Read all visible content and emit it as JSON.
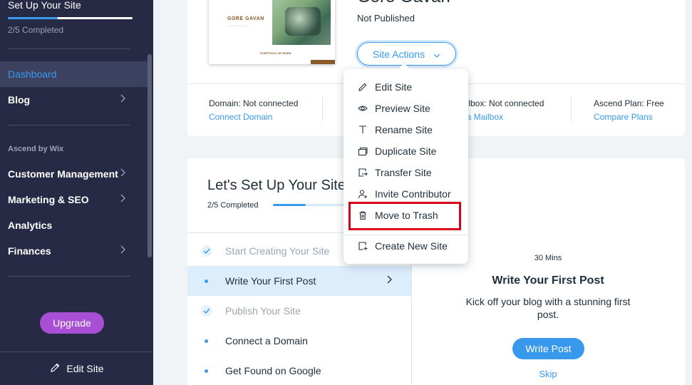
{
  "sidebar": {
    "setup_title": "Set Up Your Site",
    "setup_progress_fraction": 0.4,
    "setup_completed": "2/5 Completed",
    "items": [
      {
        "label": "Dashboard",
        "active": true
      },
      {
        "label": "Blog",
        "has_chevron": true
      }
    ],
    "section_label": "Ascend by Wix",
    "section_items": [
      {
        "label": "Customer Management",
        "has_chevron": true
      },
      {
        "label": "Marketing & SEO",
        "has_chevron": true
      },
      {
        "label": "Analytics",
        "has_chevron": false
      },
      {
        "label": "Finances",
        "has_chevron": true
      }
    ],
    "upgrade_label": "Upgrade",
    "edit_site_label": "Edit Site"
  },
  "site": {
    "name": "Gore Gavan",
    "status": "Not Published",
    "actions_label": "Site Actions",
    "thumbnail": {
      "name": "GORE GAVAN",
      "portfolio": "PORTFOLIO OF WORK"
    },
    "info": [
      {
        "label": "Domain: Not connected",
        "link": "Connect Domain"
      },
      {
        "label": "ailbox: Not connected",
        "link": "t a Mailbox"
      },
      {
        "label": "Ascend Plan: Free",
        "link": "Compare Plans"
      }
    ]
  },
  "setup": {
    "title": "Let's Set Up Your Site",
    "completed": "2/5 Completed",
    "progress_fraction": 0.4,
    "tasks": [
      {
        "label": "Start Creating Your Site",
        "state": "done"
      },
      {
        "label": "Write Your First Post",
        "state": "active"
      },
      {
        "label": "Publish Your Site",
        "state": "done"
      },
      {
        "label": "Connect a Domain",
        "state": "todo"
      },
      {
        "label": "Get Found on Google",
        "state": "todo"
      }
    ],
    "detail": {
      "time": "30 Mins",
      "title": "Write Your First Post",
      "description": "Kick off your blog with a stunning first post.",
      "button": "Write Post",
      "skip": "Skip"
    }
  },
  "menu": {
    "items": [
      {
        "label": "Edit Site",
        "icon": "pencil-icon"
      },
      {
        "label": "Preview Site",
        "icon": "eye-icon"
      },
      {
        "label": "Rename Site",
        "icon": "text-icon"
      },
      {
        "label": "Duplicate Site",
        "icon": "duplicate-icon"
      },
      {
        "label": "Transfer Site",
        "icon": "transfer-icon"
      },
      {
        "label": "Invite Contributor",
        "icon": "invite-user-icon"
      },
      {
        "label": "Move to Trash",
        "icon": "trash-icon",
        "highlighted": true
      },
      {
        "label": "Create New Site",
        "icon": "new-site-icon"
      }
    ]
  },
  "colors": {
    "sidebar_bg": "#272a45",
    "accent": "#3899ec",
    "upgrade": "#a94fd6",
    "highlight_border": "#d9001b"
  }
}
